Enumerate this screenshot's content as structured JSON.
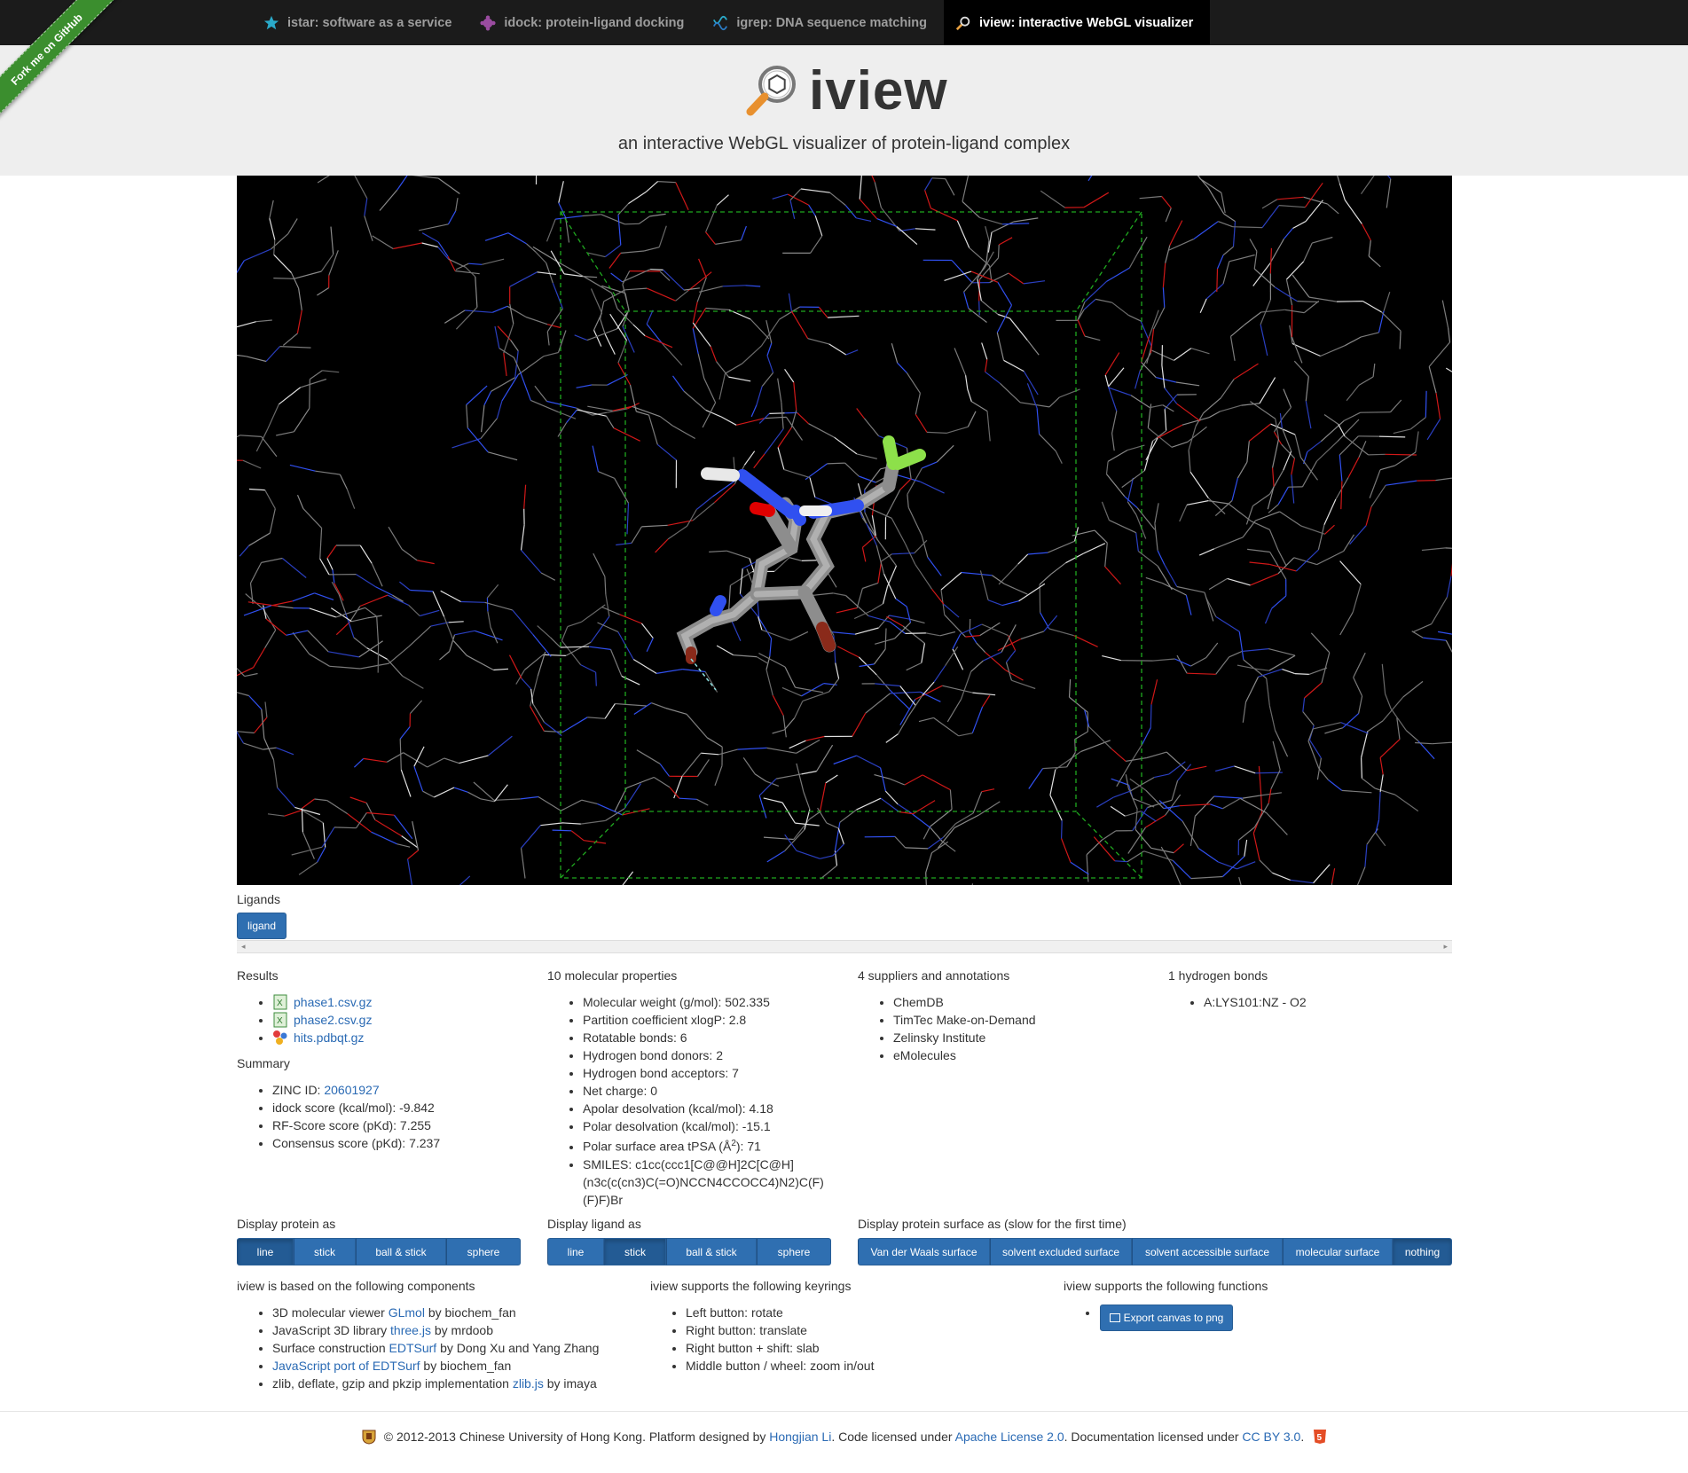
{
  "nav": {
    "tabs": [
      {
        "label": "istar: software as a service",
        "icon": "star-icon"
      },
      {
        "label": "idock: protein-ligand docking",
        "icon": "puzzle-icon"
      },
      {
        "label": "igrep: DNA sequence matching",
        "icon": "dna-icon"
      },
      {
        "label": "iview: interactive WebGL visualizer",
        "icon": "magnifier-icon"
      }
    ],
    "active": 3
  },
  "ribbon": "Fork me on GitHub",
  "header": {
    "title": "iview",
    "tagline": "an interactive WebGL visualizer of protein-ligand complex"
  },
  "ligands": {
    "label": "Ligands",
    "items": [
      "ligand"
    ]
  },
  "results": {
    "heading": "Results",
    "files": [
      "phase1.csv.gz",
      "phase2.csv.gz",
      "hits.pdbqt.gz"
    ]
  },
  "summary": {
    "heading": "Summary",
    "zinc_label": "ZINC ID: ",
    "zinc_id": "20601927",
    "items": [
      "idock score (kcal/mol): -9.842",
      "RF-Score score (pKd): 7.255",
      "Consensus score (pKd): 7.237"
    ]
  },
  "properties": {
    "heading": "10 molecular properties",
    "items": [
      "Molecular weight (g/mol): 502.335",
      "Partition coefficient xlogP: 2.8",
      "Rotatable bonds: 6",
      "Hydrogen bond donors: 2",
      "Hydrogen bond acceptors: 7",
      "Net charge: 0",
      "Apolar desolvation (kcal/mol): 4.18",
      "Polar desolvation (kcal/mol): -15.1"
    ],
    "tpsa_pre": "Polar surface area tPSA (Å",
    "tpsa_sup": "2",
    "tpsa_post": "): 71",
    "smiles_lines": [
      "SMILES: c1cc(ccc1[C@@H]2C[C@H]",
      "(n3c(c(cn3)C(=O)NCCN4CCOCC4)N2)C(F)",
      "(F)F)Br"
    ]
  },
  "suppliers": {
    "heading": "4 suppliers and annotations",
    "items": [
      "ChemDB",
      "TimTec Make-on-Demand",
      "Zelinsky Institute",
      "eMolecules"
    ]
  },
  "hbonds": {
    "heading": "1 hydrogen bonds",
    "items": [
      "A:LYS101:NZ - O2"
    ]
  },
  "display_protein": {
    "label": "Display protein as",
    "options": [
      "line",
      "stick",
      "ball & stick",
      "sphere"
    ],
    "active": 0
  },
  "display_ligand": {
    "label": "Display ligand as",
    "options": [
      "line",
      "stick",
      "ball & stick",
      "sphere"
    ],
    "active": 1
  },
  "display_surface": {
    "label": "Display protein surface as (slow for the first time)",
    "options": [
      "Van der Waals surface",
      "solvent excluded surface",
      "solvent accessible surface",
      "molecular surface",
      "nothing"
    ],
    "active": 4
  },
  "components": {
    "heading": "iview is based on the following components",
    "items": [
      {
        "pre": "3D molecular viewer ",
        "link": "GLmol",
        "post": " by biochem_fan"
      },
      {
        "pre": "JavaScript 3D library ",
        "link": "three.js",
        "post": " by mrdoob"
      },
      {
        "pre": "Surface construction ",
        "link": "EDTSurf",
        "post": " by Dong Xu and Yang Zhang"
      },
      {
        "pre": "",
        "link": "JavaScript port of EDTSurf",
        "post": " by biochem_fan"
      },
      {
        "pre": "zlib, deflate, gzip and pkzip implementation ",
        "link": "zlib.js",
        "post": " by imaya"
      }
    ]
  },
  "keyrings": {
    "heading": "iview supports the following keyrings",
    "items": [
      "Left button: rotate",
      "Right button: translate",
      "Right button + shift: slab",
      "Middle button / wheel: zoom in/out"
    ]
  },
  "functions": {
    "heading": "iview supports the following functions",
    "export_label": "Export canvas to png"
  },
  "footer": {
    "copyright": "© 2012-2013 Chinese University of Hong Kong. Platform designed by ",
    "designer": "Hongjian Li",
    "code_text": ". Code licensed under ",
    "code_license": "Apache License 2.0",
    "doc_text": ". Documentation licensed under ",
    "doc_license": "CC BY 3.0",
    "end": "."
  },
  "colors": {
    "accent": "#2f6fb1",
    "nav_bg": "#1b1b1b",
    "header_bg": "#eeeeee",
    "ribbon": "#3b8e2e",
    "link": "#2a6ab4"
  }
}
